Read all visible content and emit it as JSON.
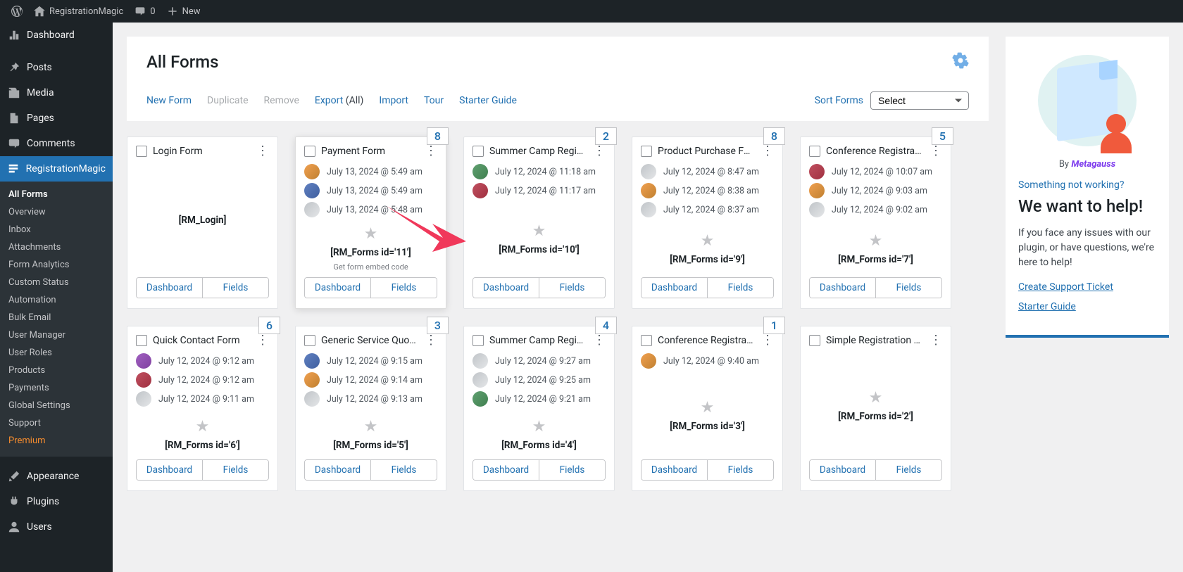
{
  "adminbar": {
    "site": "RegistrationMagic",
    "comments": "0",
    "new": "New"
  },
  "sidebar": {
    "main": [
      {
        "icon": "dashboard",
        "label": "Dashboard"
      },
      {
        "icon": "pin",
        "label": "Posts"
      },
      {
        "icon": "media",
        "label": "Media"
      },
      {
        "icon": "page",
        "label": "Pages"
      },
      {
        "icon": "comment",
        "label": "Comments"
      }
    ],
    "app_label": "RegistrationMagic",
    "subs": [
      "All Forms",
      "Overview",
      "Inbox",
      "Attachments",
      "Form Analytics",
      "Custom Status",
      "Automation",
      "Bulk Email",
      "User Manager",
      "User Roles",
      "Products",
      "Payments",
      "Global Settings",
      "Support"
    ],
    "premium": "Premium",
    "tail": [
      {
        "icon": "brush",
        "label": "Appearance"
      },
      {
        "icon": "plug",
        "label": "Plugins"
      },
      {
        "icon": "user",
        "label": "Users"
      }
    ]
  },
  "page": {
    "title": "All Forms"
  },
  "toolbar": {
    "new": "New Form",
    "duplicate": "Duplicate",
    "remove": "Remove",
    "export": "Export",
    "export_all": "(All)",
    "import": "Import",
    "tour": "Tour",
    "starter": "Starter Guide",
    "sort_label": "Sort Forms",
    "sort_value": "Select"
  },
  "card_btn": {
    "dashboard": "Dashboard",
    "fields": "Fields"
  },
  "cards": [
    {
      "title": "Login Form",
      "badge": "",
      "shortcode": "[RM_Login]",
      "subs": [],
      "showStar": false
    },
    {
      "title": "Payment Form",
      "badge": "8",
      "shortcode": "[RM_Forms id='11']",
      "highlighted": true,
      "showEmbed": true,
      "subs": [
        {
          "av": "av-1",
          "t": "July 13, 2024 @ 5:49 am"
        },
        {
          "av": "av-2",
          "t": "July 13, 2024 @ 5:49 am"
        },
        {
          "av": "",
          "t": "July 13, 2024 @ 5:48 am"
        }
      ]
    },
    {
      "title": "Summer Camp Registr…",
      "badge": "2",
      "shortcode": "[RM_Forms id='10']",
      "subs": [
        {
          "av": "av-4",
          "t": "July 12, 2024 @ 11:18 am"
        },
        {
          "av": "av-3",
          "t": "July 12, 2024 @ 11:17 am"
        }
      ]
    },
    {
      "title": "Product Purchase Form",
      "badge": "8",
      "shortcode": "[RM_Forms id='9']",
      "subs": [
        {
          "av": "",
          "t": "July 12, 2024 @ 8:47 am"
        },
        {
          "av": "av-1",
          "t": "July 12, 2024 @ 8:38 am"
        },
        {
          "av": "",
          "t": "July 12, 2024 @ 8:37 am"
        }
      ]
    },
    {
      "title": "Conference Registrati…",
      "badge": "5",
      "shortcode": "[RM_Forms id='7']",
      "subs": [
        {
          "av": "av-3",
          "t": "July 12, 2024 @ 10:07 am"
        },
        {
          "av": "av-1",
          "t": "July 12, 2024 @ 9:03 am"
        },
        {
          "av": "",
          "t": "July 12, 2024 @ 9:02 am"
        }
      ]
    },
    {
      "title": "Quick Contact Form",
      "badge": "6",
      "shortcode": "[RM_Forms id='6']",
      "subs": [
        {
          "av": "av-5",
          "t": "July 12, 2024 @ 9:12 am"
        },
        {
          "av": "av-3",
          "t": "July 12, 2024 @ 9:12 am"
        },
        {
          "av": "",
          "t": "July 12, 2024 @ 9:11 am"
        }
      ]
    },
    {
      "title": "Generic Service Quote…",
      "badge": "3",
      "shortcode": "[RM_Forms id='5']",
      "subs": [
        {
          "av": "av-2",
          "t": "July 12, 2024 @ 9:15 am"
        },
        {
          "av": "av-1",
          "t": "July 12, 2024 @ 9:14 am"
        },
        {
          "av": "",
          "t": "July 12, 2024 @ 9:13 am"
        }
      ]
    },
    {
      "title": "Summer Camp Registr…",
      "badge": "4",
      "shortcode": "[RM_Forms id='4']",
      "subs": [
        {
          "av": "",
          "t": "July 12, 2024 @ 9:27 am"
        },
        {
          "av": "",
          "t": "July 12, 2024 @ 9:25 am"
        },
        {
          "av": "av-4",
          "t": "July 12, 2024 @ 9:21 am"
        }
      ]
    },
    {
      "title": "Conference Registrati…",
      "badge": "1",
      "shortcode": "[RM_Forms id='3']",
      "subs": [
        {
          "av": "av-1",
          "t": "July 12, 2024 @ 9:40 am"
        }
      ]
    },
    {
      "title": "Simple Registration Fo…",
      "badge": "",
      "shortcode": "[RM_Forms id='2']",
      "subs": []
    }
  ],
  "embed_note": "Get form embed code",
  "aside": {
    "brand_by": "By",
    "brand_name": "Metagauss",
    "q": "Something not working?",
    "h": "We want to help!",
    "p": "If you face any issues with our plugin, or have questions, we're here to help!",
    "l1": "Create Support Ticket",
    "l2": "Starter Guide"
  }
}
